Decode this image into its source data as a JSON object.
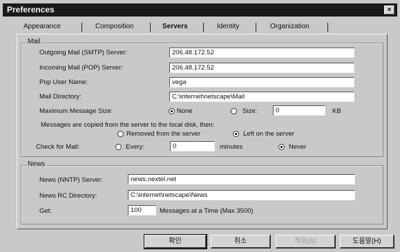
{
  "window": {
    "title": "Preferences",
    "close_glyph": "×"
  },
  "tabs": [
    "Appearance",
    "Composition",
    "Servers",
    "Identity",
    "Organization"
  ],
  "active_tab": "Servers",
  "mail": {
    "group_label": "Mail",
    "smtp_label": "Outgoing Mail (SMTP) Server:",
    "smtp_value": "206.48.172.52",
    "pop_label": "Incoming Mail (POP) Server:",
    "pop_value": "206.48.172.52",
    "user_label": "Pop User Name:",
    "user_value": "vega",
    "dir_label": "Mail Directory:",
    "dir_value": "C:\\internet\\netscape\\Mail",
    "max_size_label": "Maximum Message Size:",
    "max_none_label": "None",
    "max_size_option_label": "Size:",
    "max_size_value": "0",
    "max_size_unit": "KB",
    "max_size_selected": "None",
    "copied_text": "Messages are copied from the server to the local disk, then:",
    "removed_label": "Removed from the server",
    "left_label": "Left on the server",
    "copy_selected": "Left on the server",
    "check_label": "Check for Mail:",
    "every_label": "Every:",
    "every_value": "0",
    "minutes_label": "minutes",
    "never_label": "Never",
    "check_selected": "Never"
  },
  "news": {
    "group_label": "News",
    "nntp_label": "News (NNTP) Server:",
    "nntp_value": "news.nextel.net",
    "rc_label": "News RC Directory:",
    "rc_value": "C:\\internet\\netscape\\News",
    "get_label": "Get:",
    "get_value": "100",
    "get_suffix": "Messages at a Time (Max 3500)"
  },
  "buttons": {
    "ok": "확인",
    "cancel": "취소",
    "apply": "적용(A)",
    "help": "도움말(H)"
  }
}
